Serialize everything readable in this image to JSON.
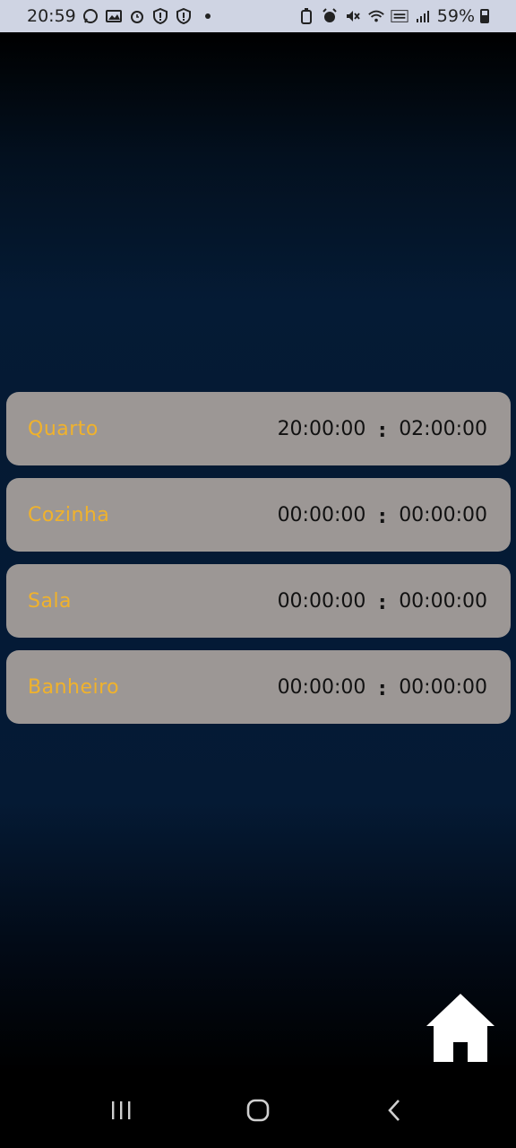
{
  "status_bar": {
    "time": "20:59",
    "battery_percent": "59%",
    "left_icons": [
      "whatsapp-icon",
      "gallery-icon",
      "alarm-icon",
      "shield-alert-icon",
      "shield-alert-icon"
    ],
    "right_icons": [
      "battery-saver-icon",
      "alarm-icon",
      "mute-icon",
      "wifi-icon",
      "volte-icon",
      "signal-icon"
    ]
  },
  "rooms": [
    {
      "name": "Quarto",
      "start": "20:00:00",
      "end": "02:00:00"
    },
    {
      "name": "Cozinha",
      "start": "00:00:00",
      "end": "00:00:00"
    },
    {
      "name": "Sala",
      "start": "00:00:00",
      "end": "00:00:00"
    },
    {
      "name": "Banheiro",
      "start": "00:00:00",
      "end": "00:00:00"
    }
  ],
  "separator": ":",
  "colors": {
    "card_background": "#9c9795",
    "room_name": "#f0b22c",
    "status_bar": "#cfd4e3"
  },
  "home_button_icon": "home-icon",
  "nav_bar": [
    "recent-apps-icon",
    "home-nav-icon",
    "back-icon"
  ]
}
